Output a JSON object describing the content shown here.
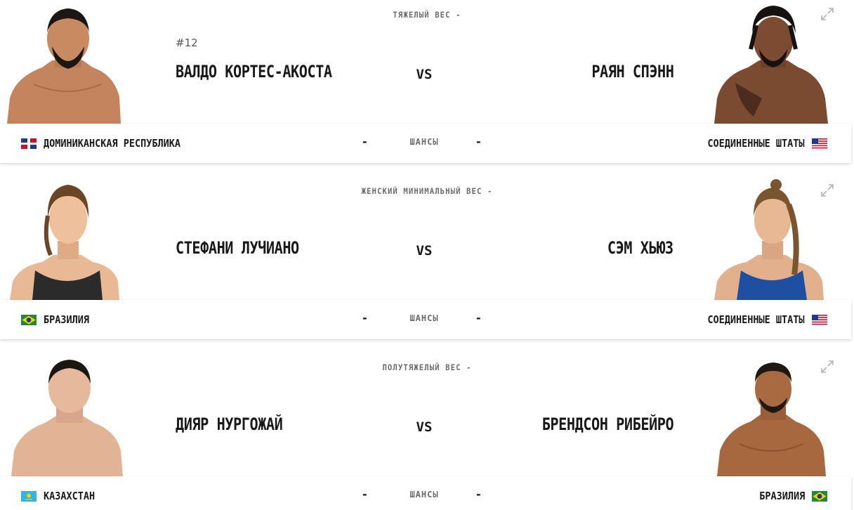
{
  "bouts": [
    {
      "weight_class": "ТЯЖЕЛЫЙ ВЕС -",
      "red": {
        "rank": "#12",
        "name": "ВАЛДО КОРТЕС-АКОСТА",
        "country": "ДОМИНИКАНСКАЯ РЕСПУБЛИКА",
        "odds": "-"
      },
      "vs": "VS",
      "odds_label": "ШАНСЫ",
      "blue": {
        "name": "РАЯН СПЭНН",
        "country": "СОЕДИНЕННЫЕ ШТАТЫ",
        "odds": "-"
      }
    },
    {
      "weight_class": "ЖЕНСКИЙ МИНИМАЛЬНЫЙ ВЕС -",
      "red": {
        "name": "СТЕФАНИ ЛУЧИАНО",
        "country": "БРАЗИЛИЯ",
        "odds": "-"
      },
      "vs": "VS",
      "odds_label": "ШАНСЫ",
      "blue": {
        "name": "СЭМ ХЬЮЗ",
        "country": "СОЕДИНЕННЫЕ ШТАТЫ",
        "odds": "-"
      }
    },
    {
      "weight_class": "ПОЛУТЯЖЕЛЫЙ ВЕС -",
      "red": {
        "name": "ДИЯР НУРГОЖАЙ",
        "country": "КАЗАХСТАН",
        "odds": "-"
      },
      "vs": "VS",
      "odds_label": "ШАНСЫ",
      "blue": {
        "name": "БРЕНДСОН РИБЕЙРО",
        "country": "БРАЗИЛИЯ",
        "odds": "-"
      }
    }
  ],
  "colors": {
    "text": "#191919",
    "muted": "#6b6b6b",
    "background": "#ffffff"
  },
  "icons": {
    "expand": "expand-icon"
  }
}
